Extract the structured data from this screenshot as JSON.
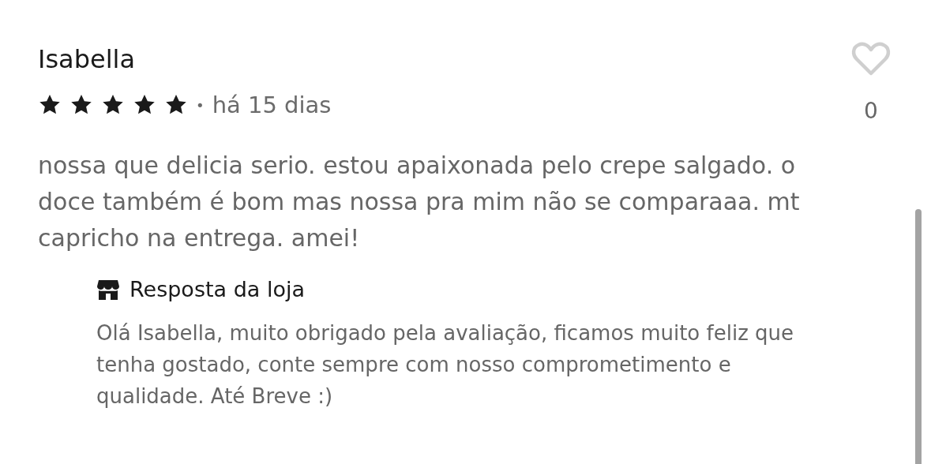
{
  "review": {
    "author": "Isabella",
    "stars": 5,
    "separator": "•",
    "date": "há 15 dias",
    "liked": false,
    "like_count": "0",
    "text": "nossa que delicia serio. estou apaixonada pelo crepe salgado. o doce também é bom mas nossa pra mim não se comparaaa. mt capricho na entrega. amei!",
    "reply": {
      "title": "Resposta da loja",
      "text": "Olá Isabella, muito obrigado pela avaliação, ficamos muito feliz que tenha gostado, conte sempre com nosso comprometimento e qualidade. Até Breve :)"
    }
  }
}
